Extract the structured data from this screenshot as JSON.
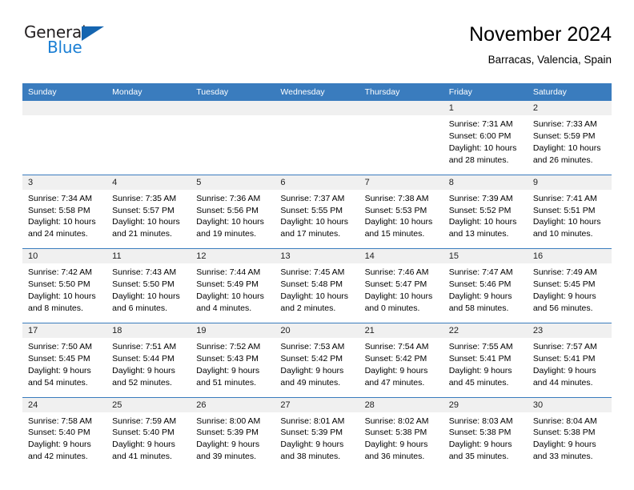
{
  "brand": {
    "name_part1": "General",
    "name_part2": "Blue"
  },
  "header": {
    "title": "November 2024",
    "location": "Barracas, Valencia, Spain"
  },
  "colors": {
    "header_blue": "#3a7cbe",
    "logo_blue": "#1b7fd4",
    "daynum_band": "#f0f0f0"
  },
  "weekday_headers": [
    "Sunday",
    "Monday",
    "Tuesday",
    "Wednesday",
    "Thursday",
    "Friday",
    "Saturday"
  ],
  "labels": {
    "sunrise_prefix": "Sunrise:",
    "sunset_prefix": "Sunset:",
    "daylight_prefix": "Daylight:"
  },
  "weeks": [
    {
      "days": [
        {
          "num": "",
          "blank": true,
          "l1": "",
          "l2": "",
          "l3": "",
          "l4": ""
        },
        {
          "num": "",
          "blank": true,
          "l1": "",
          "l2": "",
          "l3": "",
          "l4": ""
        },
        {
          "num": "",
          "blank": true,
          "l1": "",
          "l2": "",
          "l3": "",
          "l4": ""
        },
        {
          "num": "",
          "blank": true,
          "l1": "",
          "l2": "",
          "l3": "",
          "l4": ""
        },
        {
          "num": "",
          "blank": true,
          "l1": "",
          "l2": "",
          "l3": "",
          "l4": ""
        },
        {
          "num": "1",
          "blank": false,
          "l1": "Sunrise: 7:31 AM",
          "l2": "Sunset: 6:00 PM",
          "l3": "Daylight: 10 hours",
          "l4": "and 28 minutes."
        },
        {
          "num": "2",
          "blank": false,
          "l1": "Sunrise: 7:33 AM",
          "l2": "Sunset: 5:59 PM",
          "l3": "Daylight: 10 hours",
          "l4": "and 26 minutes."
        }
      ]
    },
    {
      "days": [
        {
          "num": "3",
          "blank": false,
          "l1": "Sunrise: 7:34 AM",
          "l2": "Sunset: 5:58 PM",
          "l3": "Daylight: 10 hours",
          "l4": "and 24 minutes."
        },
        {
          "num": "4",
          "blank": false,
          "l1": "Sunrise: 7:35 AM",
          "l2": "Sunset: 5:57 PM",
          "l3": "Daylight: 10 hours",
          "l4": "and 21 minutes."
        },
        {
          "num": "5",
          "blank": false,
          "l1": "Sunrise: 7:36 AM",
          "l2": "Sunset: 5:56 PM",
          "l3": "Daylight: 10 hours",
          "l4": "and 19 minutes."
        },
        {
          "num": "6",
          "blank": false,
          "l1": "Sunrise: 7:37 AM",
          "l2": "Sunset: 5:55 PM",
          "l3": "Daylight: 10 hours",
          "l4": "and 17 minutes."
        },
        {
          "num": "7",
          "blank": false,
          "l1": "Sunrise: 7:38 AM",
          "l2": "Sunset: 5:53 PM",
          "l3": "Daylight: 10 hours",
          "l4": "and 15 minutes."
        },
        {
          "num": "8",
          "blank": false,
          "l1": "Sunrise: 7:39 AM",
          "l2": "Sunset: 5:52 PM",
          "l3": "Daylight: 10 hours",
          "l4": "and 13 minutes."
        },
        {
          "num": "9",
          "blank": false,
          "l1": "Sunrise: 7:41 AM",
          "l2": "Sunset: 5:51 PM",
          "l3": "Daylight: 10 hours",
          "l4": "and 10 minutes."
        }
      ]
    },
    {
      "days": [
        {
          "num": "10",
          "blank": false,
          "l1": "Sunrise: 7:42 AM",
          "l2": "Sunset: 5:50 PM",
          "l3": "Daylight: 10 hours",
          "l4": "and 8 minutes."
        },
        {
          "num": "11",
          "blank": false,
          "l1": "Sunrise: 7:43 AM",
          "l2": "Sunset: 5:50 PM",
          "l3": "Daylight: 10 hours",
          "l4": "and 6 minutes."
        },
        {
          "num": "12",
          "blank": false,
          "l1": "Sunrise: 7:44 AM",
          "l2": "Sunset: 5:49 PM",
          "l3": "Daylight: 10 hours",
          "l4": "and 4 minutes."
        },
        {
          "num": "13",
          "blank": false,
          "l1": "Sunrise: 7:45 AM",
          "l2": "Sunset: 5:48 PM",
          "l3": "Daylight: 10 hours",
          "l4": "and 2 minutes."
        },
        {
          "num": "14",
          "blank": false,
          "l1": "Sunrise: 7:46 AM",
          "l2": "Sunset: 5:47 PM",
          "l3": "Daylight: 10 hours",
          "l4": "and 0 minutes."
        },
        {
          "num": "15",
          "blank": false,
          "l1": "Sunrise: 7:47 AM",
          "l2": "Sunset: 5:46 PM",
          "l3": "Daylight: 9 hours",
          "l4": "and 58 minutes."
        },
        {
          "num": "16",
          "blank": false,
          "l1": "Sunrise: 7:49 AM",
          "l2": "Sunset: 5:45 PM",
          "l3": "Daylight: 9 hours",
          "l4": "and 56 minutes."
        }
      ]
    },
    {
      "days": [
        {
          "num": "17",
          "blank": false,
          "l1": "Sunrise: 7:50 AM",
          "l2": "Sunset: 5:45 PM",
          "l3": "Daylight: 9 hours",
          "l4": "and 54 minutes."
        },
        {
          "num": "18",
          "blank": false,
          "l1": "Sunrise: 7:51 AM",
          "l2": "Sunset: 5:44 PM",
          "l3": "Daylight: 9 hours",
          "l4": "and 52 minutes."
        },
        {
          "num": "19",
          "blank": false,
          "l1": "Sunrise: 7:52 AM",
          "l2": "Sunset: 5:43 PM",
          "l3": "Daylight: 9 hours",
          "l4": "and 51 minutes."
        },
        {
          "num": "20",
          "blank": false,
          "l1": "Sunrise: 7:53 AM",
          "l2": "Sunset: 5:42 PM",
          "l3": "Daylight: 9 hours",
          "l4": "and 49 minutes."
        },
        {
          "num": "21",
          "blank": false,
          "l1": "Sunrise: 7:54 AM",
          "l2": "Sunset: 5:42 PM",
          "l3": "Daylight: 9 hours",
          "l4": "and 47 minutes."
        },
        {
          "num": "22",
          "blank": false,
          "l1": "Sunrise: 7:55 AM",
          "l2": "Sunset: 5:41 PM",
          "l3": "Daylight: 9 hours",
          "l4": "and 45 minutes."
        },
        {
          "num": "23",
          "blank": false,
          "l1": "Sunrise: 7:57 AM",
          "l2": "Sunset: 5:41 PM",
          "l3": "Daylight: 9 hours",
          "l4": "and 44 minutes."
        }
      ]
    },
    {
      "days": [
        {
          "num": "24",
          "blank": false,
          "l1": "Sunrise: 7:58 AM",
          "l2": "Sunset: 5:40 PM",
          "l3": "Daylight: 9 hours",
          "l4": "and 42 minutes."
        },
        {
          "num": "25",
          "blank": false,
          "l1": "Sunrise: 7:59 AM",
          "l2": "Sunset: 5:40 PM",
          "l3": "Daylight: 9 hours",
          "l4": "and 41 minutes."
        },
        {
          "num": "26",
          "blank": false,
          "l1": "Sunrise: 8:00 AM",
          "l2": "Sunset: 5:39 PM",
          "l3": "Daylight: 9 hours",
          "l4": "and 39 minutes."
        },
        {
          "num": "27",
          "blank": false,
          "l1": "Sunrise: 8:01 AM",
          "l2": "Sunset: 5:39 PM",
          "l3": "Daylight: 9 hours",
          "l4": "and 38 minutes."
        },
        {
          "num": "28",
          "blank": false,
          "l1": "Sunrise: 8:02 AM",
          "l2": "Sunset: 5:38 PM",
          "l3": "Daylight: 9 hours",
          "l4": "and 36 minutes."
        },
        {
          "num": "29",
          "blank": false,
          "l1": "Sunrise: 8:03 AM",
          "l2": "Sunset: 5:38 PM",
          "l3": "Daylight: 9 hours",
          "l4": "and 35 minutes."
        },
        {
          "num": "30",
          "blank": false,
          "l1": "Sunrise: 8:04 AM",
          "l2": "Sunset: 5:38 PM",
          "l3": "Daylight: 9 hours",
          "l4": "and 33 minutes."
        }
      ]
    }
  ]
}
